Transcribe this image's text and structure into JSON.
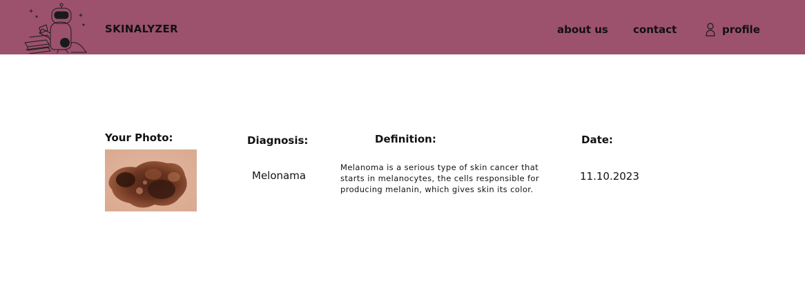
{
  "header": {
    "brand": "SKINALYZER",
    "nav": {
      "about": "about us",
      "contact": "contact",
      "profile": "profile"
    },
    "logo_icon": "robot-reading-books-logo",
    "profile_icon": "user-icon",
    "background_color": "#9c516d"
  },
  "result": {
    "headers": {
      "photo": "Your Photo:",
      "diagnosis": "Diagnosis:",
      "definition": "Definition:",
      "date": "Date:"
    },
    "diagnosis": "Melonama",
    "definition": "Melanoma is a serious type of skin cancer that starts in melanocytes, the cells responsible for producing melanin, which gives skin its color.",
    "date": "11.10.2023"
  }
}
